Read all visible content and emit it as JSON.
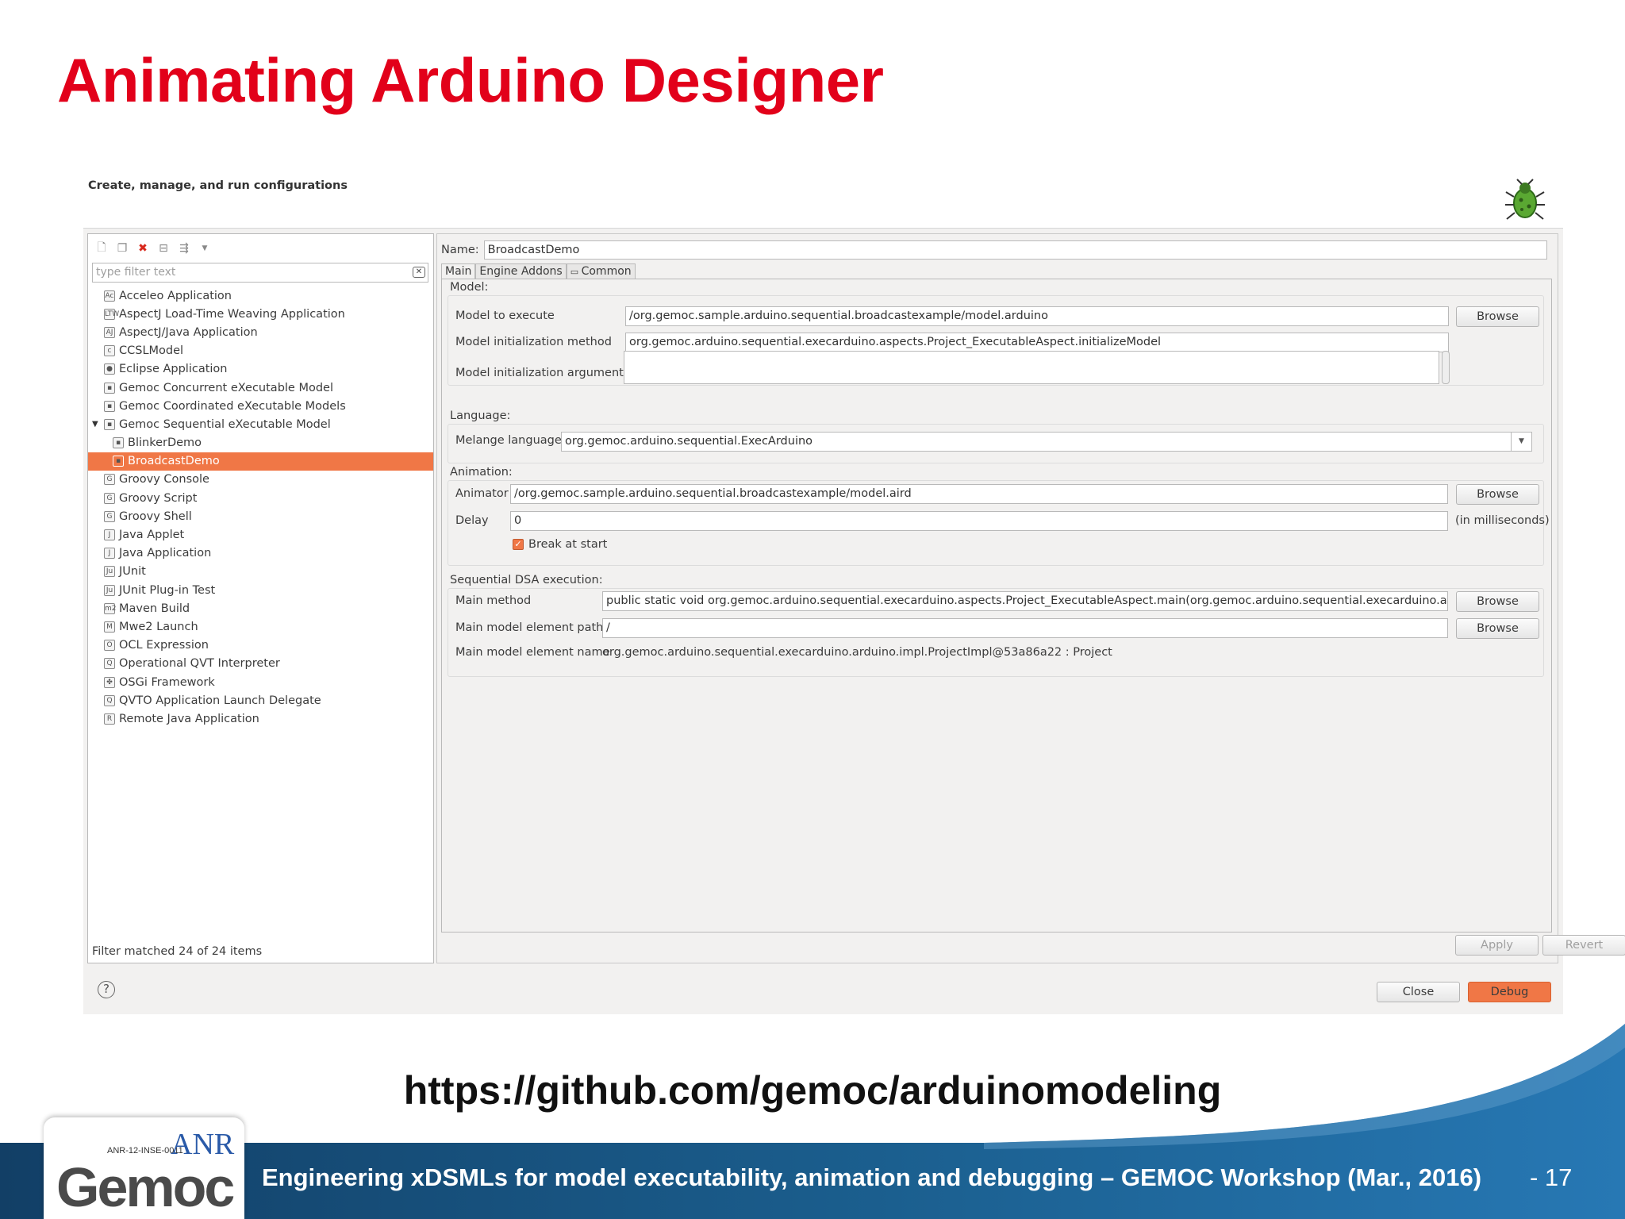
{
  "slide": {
    "title": "Animating Arduino Designer",
    "url": "https://github.com/gemoc/arduinomodeling",
    "footer": "Engineering xDSMLs for model executability, animation and debugging – GEMOC Workshop (Mar., 2016)",
    "page": "- 17",
    "logo_code": "ANR-12-INSE-0011",
    "logo_anr": "ANR",
    "logo_gemoc": "Gemoc"
  },
  "dialog": {
    "header": "Create, manage, and run configurations",
    "filter_placeholder": "type filter text",
    "filter_status": "Filter matched 24 of 24 items",
    "tree": [
      {
        "label": "Acceleo Application",
        "icon": "Ac"
      },
      {
        "label": "AspectJ Load-Time Weaving Application",
        "icon": "LTW"
      },
      {
        "label": "AspectJ/Java Application",
        "icon": "AJ"
      },
      {
        "label": "CCSLModel",
        "icon": "c"
      },
      {
        "label": "Eclipse Application",
        "icon": "●"
      },
      {
        "label": "Gemoc Concurrent eXecutable Model",
        "icon": "▪"
      },
      {
        "label": "Gemoc Coordinated eXecutable Models",
        "icon": "▪"
      },
      {
        "label": "Gemoc Sequential eXecutable Model",
        "icon": "▪",
        "expanded": true
      },
      {
        "label": "BlinkerDemo",
        "icon": "▪",
        "child": true
      },
      {
        "label": "BroadcastDemo",
        "icon": "▪",
        "child": true,
        "selected": true
      },
      {
        "label": "Groovy Console",
        "icon": "G"
      },
      {
        "label": "Groovy Script",
        "icon": "G"
      },
      {
        "label": "Groovy Shell",
        "icon": "G"
      },
      {
        "label": "Java Applet",
        "icon": "J"
      },
      {
        "label": "Java Application",
        "icon": "J"
      },
      {
        "label": "JUnit",
        "icon": "Ju"
      },
      {
        "label": "JUnit Plug-in Test",
        "icon": "Ju"
      },
      {
        "label": "Maven Build",
        "icon": "m2"
      },
      {
        "label": "Mwe2 Launch",
        "icon": "M"
      },
      {
        "label": "OCL Expression",
        "icon": "O"
      },
      {
        "label": "Operational QVT Interpreter",
        "icon": "Q"
      },
      {
        "label": "OSGi Framework",
        "icon": "✤"
      },
      {
        "label": "QVTO Application Launch Delegate",
        "icon": "Q"
      },
      {
        "label": "Remote Java Application",
        "icon": "R"
      }
    ],
    "name_label": "Name:",
    "name_value": "BroadcastDemo",
    "tabs": [
      "Main",
      "Engine Addons",
      "Common"
    ],
    "model": {
      "section": "Model:",
      "execute_label": "Model to execute",
      "execute_value": "/org.gemoc.sample.arduino.sequential.broadcastexample/model.arduino",
      "init_method_label": "Model initialization method",
      "init_method_value": "org.gemoc.arduino.sequential.execarduino.aspects.Project_ExecutableAspect.initializeModel",
      "init_args_label": "Model initialization arguments",
      "init_args_value": ""
    },
    "language": {
      "section": "Language:",
      "melange_label": "Melange languages",
      "melange_value": "org.gemoc.arduino.sequential.ExecArduino"
    },
    "animation": {
      "section": "Animation:",
      "animator_label": "Animator",
      "animator_value": "/org.gemoc.sample.arduino.sequential.broadcastexample/model.aird",
      "delay_label": "Delay",
      "delay_value": "0",
      "delay_unit": "(in milliseconds)",
      "break_label": "Break at start",
      "break_checked": true
    },
    "dsa": {
      "section": "Sequential DSA execution:",
      "main_method_label": "Main method",
      "main_method_value": "public static void org.gemoc.arduino.sequential.execarduino.aspects.Project_ExecutableAspect.main(org.gemoc.arduino.sequential.execarduino.arduino.Pr",
      "element_path_label": "Main model element path",
      "element_path_value": "/",
      "element_name_label": "Main model element name",
      "element_name_value": "org.gemoc.arduino.sequential.execarduino.arduino.impl.ProjectImpl@53a86a22 : Project"
    },
    "buttons": {
      "browse": "Browse",
      "apply": "Apply",
      "revert": "Revert",
      "close": "Close",
      "debug": "Debug"
    },
    "colors": {
      "selection": "#f07746",
      "title_red": "#e2001a",
      "footer_blue": "#1e6a9e"
    }
  }
}
